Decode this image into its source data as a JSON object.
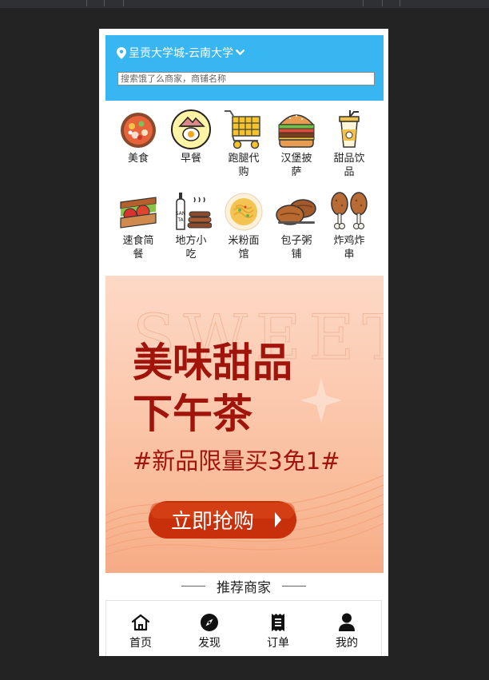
{
  "location": {
    "text": "呈贡大学城-云南大学"
  },
  "search": {
    "placeholder": "搜索饿了么商家，商铺名称"
  },
  "categories": [
    {
      "label": "美食",
      "icon": "hotpot-icon"
    },
    {
      "label": "早餐",
      "icon": "breakfast-egg-icon"
    },
    {
      "label": "跑腿代购",
      "icon": "shopping-cart-icon"
    },
    {
      "label": "汉堡披萨",
      "icon": "burger-icon"
    },
    {
      "label": "甜品饮品",
      "icon": "drink-cup-icon"
    },
    {
      "label": "速食简餐",
      "icon": "sandwich-icon"
    },
    {
      "label": "地方小吃",
      "icon": "local-snack-icon"
    },
    {
      "label": "米粉面馆",
      "icon": "noodle-bowl-icon"
    },
    {
      "label": "包子粥铺",
      "icon": "bun-icon"
    },
    {
      "label": "炸鸡炸串",
      "icon": "fried-chicken-icon"
    }
  ],
  "banner": {
    "bg_word": "SWEET",
    "line1": "美味甜品",
    "line2": "下午茶",
    "promo": "#新品限量买3免1#",
    "button": "立即抢购"
  },
  "section": {
    "title": "推荐商家"
  },
  "nav": [
    {
      "label": "首页",
      "icon": "home-icon"
    },
    {
      "label": "发现",
      "icon": "compass-icon"
    },
    {
      "label": "订单",
      "icon": "receipt-icon"
    },
    {
      "label": "我的",
      "icon": "user-icon"
    }
  ],
  "colors": {
    "header": "#38b6f2",
    "banner_text": "#a0140c",
    "button": "#c8300c"
  }
}
